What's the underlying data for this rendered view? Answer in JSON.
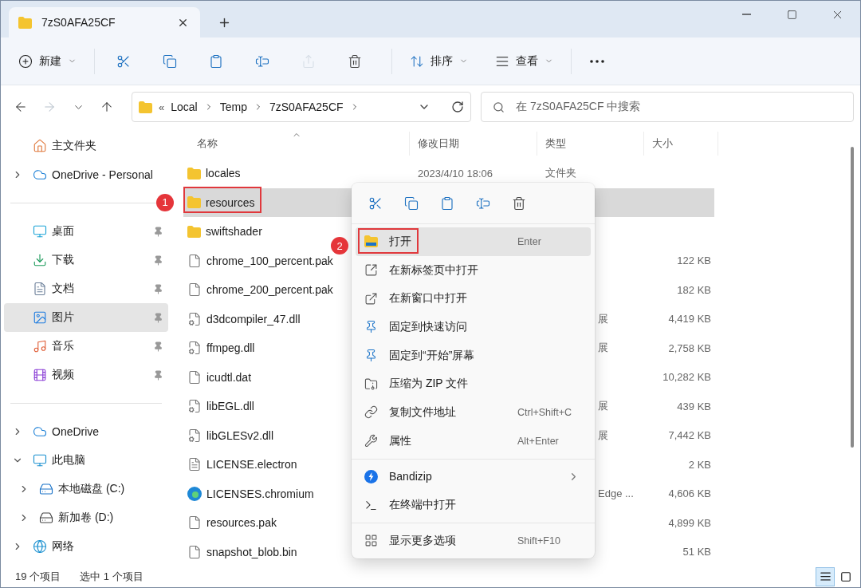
{
  "window": {
    "tab_title": "7zS0AFA25CF"
  },
  "toolbar": {
    "new_label": "新建",
    "actions": [
      {
        "kind": "cut",
        "disabled": false
      },
      {
        "kind": "copy",
        "disabled": false
      },
      {
        "kind": "paste",
        "disabled": false
      },
      {
        "kind": "rename",
        "disabled": false
      },
      {
        "kind": "share",
        "disabled": true
      },
      {
        "kind": "delete",
        "disabled": false
      }
    ],
    "sort_label": "排序",
    "view_label": "查看"
  },
  "nav_buttons": [
    {
      "kind": "back",
      "disabled": false
    },
    {
      "kind": "forward",
      "disabled": true
    },
    {
      "kind": "recent",
      "disabled": false
    },
    {
      "kind": "up",
      "disabled": false
    }
  ],
  "address": {
    "overflow": "«",
    "path": [
      "Local",
      "Temp",
      "7zS0AFA25CF"
    ]
  },
  "search": {
    "placeholder": "在 7zS0AFA25CF 中搜索"
  },
  "sidebar": {
    "groups": [
      [
        {
          "label": "主文件夹",
          "kind": "home",
          "pinned": false,
          "selected": false
        },
        {
          "label": "OneDrive - Personal",
          "kind": "cloud",
          "pinned": false,
          "selected": false,
          "expanded": false
        }
      ],
      [
        {
          "label": "桌面",
          "kind": "desktop",
          "pinned": true,
          "selected": false
        },
        {
          "label": "下载",
          "kind": "download",
          "pinned": true,
          "selected": false
        },
        {
          "label": "文档",
          "kind": "document",
          "pinned": true,
          "selected": false
        },
        {
          "label": "图片",
          "kind": "pictures",
          "pinned": true,
          "selected": true
        },
        {
          "label": "音乐",
          "kind": "music",
          "pinned": true,
          "selected": false
        },
        {
          "label": "视频",
          "kind": "video",
          "pinned": true,
          "selected": false
        }
      ],
      [
        {
          "label": "OneDrive",
          "kind": "cloud",
          "pinned": false,
          "selected": false,
          "expanded": false
        },
        {
          "label": "此电脑",
          "kind": "computer",
          "pinned": false,
          "selected": false,
          "expanded": true,
          "children": [
            {
              "label": "本地磁盘 (C:)",
              "kind": "system-drive",
              "pinned": false,
              "selected": false,
              "expanded": false
            },
            {
              "label": "新加卷 (D:)",
              "kind": "drive",
              "pinned": false,
              "selected": false,
              "expanded": false
            }
          ]
        },
        {
          "label": "网络",
          "kind": "network",
          "pinned": false,
          "selected": false,
          "expanded": false
        }
      ]
    ]
  },
  "columns": [
    {
      "label": "名称",
      "sorted": true
    },
    {
      "label": "修改日期",
      "sorted": false
    },
    {
      "label": "类型",
      "sorted": false
    },
    {
      "label": "大小",
      "sorted": false
    }
  ],
  "files": [
    {
      "name": "locales",
      "kind": "folder",
      "selected": false,
      "date": "2023/4/10 18:06",
      "type": "文件夹"
    },
    {
      "name": "resources",
      "kind": "folder",
      "selected": true,
      "callout": "1"
    },
    {
      "name": "swiftshader",
      "kind": "folder",
      "selected": false
    },
    {
      "name": "chrome_100_percent.pak",
      "kind": "file",
      "selected": false,
      "size": "122 KB"
    },
    {
      "name": "chrome_200_percent.pak",
      "kind": "file",
      "selected": false,
      "size": "182 KB"
    },
    {
      "name": "d3dcompiler_47.dll",
      "kind": "dll",
      "selected": false,
      "type_tail": "展",
      "size": "4,419 KB"
    },
    {
      "name": "ffmpeg.dll",
      "kind": "dll",
      "selected": false,
      "type_tail": "展",
      "size": "2,758 KB"
    },
    {
      "name": "icudtl.dat",
      "kind": "file",
      "selected": false,
      "size": "10,282 KB"
    },
    {
      "name": "libEGL.dll",
      "kind": "dll",
      "selected": false,
      "type_tail": "展",
      "size": "439 KB"
    },
    {
      "name": "libGLESv2.dll",
      "kind": "dll",
      "selected": false,
      "type_tail": "展",
      "size": "7,442 KB"
    },
    {
      "name": "LICENSE.electron",
      "kind": "text",
      "selected": false,
      "size": "2 KB"
    },
    {
      "name": "LICENSES.chromium",
      "kind": "edge",
      "selected": false,
      "type_tail": "Edge ...",
      "size": "4,606 KB"
    },
    {
      "name": "resources.pak",
      "kind": "file",
      "selected": false,
      "size": "4,899 KB"
    },
    {
      "name": "snapshot_blob.bin",
      "kind": "file",
      "selected": false,
      "size": "51 KB"
    }
  ],
  "context_menu": {
    "quick_actions": [
      {
        "kind": "cut"
      },
      {
        "kind": "copy"
      },
      {
        "kind": "paste"
      },
      {
        "kind": "rename"
      },
      {
        "kind": "delete"
      }
    ],
    "groups": [
      [
        {
          "label": "打开",
          "kind": "open",
          "shortcut": "Enter",
          "selected": true,
          "submenu": false,
          "callout": "2"
        },
        {
          "label": "在新标签页中打开",
          "kind": "new-tab",
          "selected": false,
          "submenu": false
        },
        {
          "label": "在新窗口中打开",
          "kind": "new-window",
          "selected": false,
          "submenu": false
        },
        {
          "label": "固定到快速访问",
          "kind": "pin",
          "selected": false,
          "submenu": false
        },
        {
          "label": "固定到“开始”屏幕",
          "kind": "pin",
          "selected": false,
          "submenu": false
        },
        {
          "label": "压缩为 ZIP 文件",
          "kind": "zip",
          "selected": false,
          "submenu": false
        },
        {
          "label": "复制文件地址",
          "kind": "copy-path",
          "shortcut": "Ctrl+Shift+C",
          "selected": false,
          "submenu": false
        },
        {
          "label": "属性",
          "kind": "properties",
          "shortcut": "Alt+Enter",
          "selected": false,
          "submenu": false
        }
      ],
      [
        {
          "label": "Bandizip",
          "kind": "bandizip",
          "selected": false,
          "submenu": true
        },
        {
          "label": "在终端中打开",
          "kind": "terminal",
          "selected": false,
          "submenu": false
        }
      ],
      [
        {
          "label": "显示更多选项",
          "kind": "more-options",
          "shortcut": "Shift+F10",
          "selected": false,
          "submenu": false
        }
      ]
    ]
  },
  "status_bar": {
    "item_count": "19 个项目",
    "selection": "选中 1 个项目",
    "views": [
      {
        "kind": "details",
        "selected": true
      },
      {
        "kind": "tiles",
        "selected": false
      }
    ]
  }
}
